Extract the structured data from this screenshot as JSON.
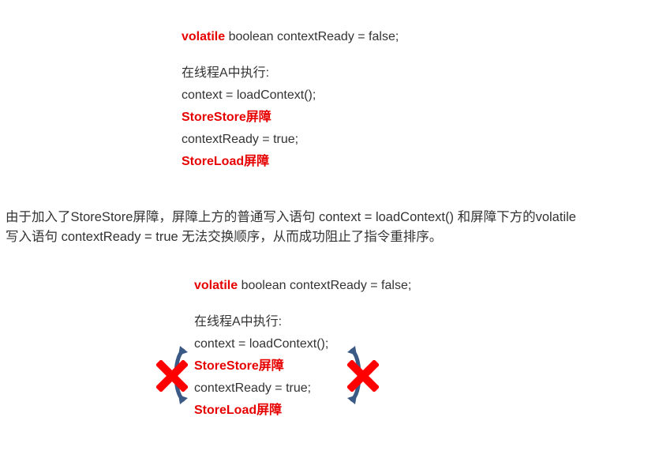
{
  "block1": {
    "decl_keyword": "volatile",
    "decl_rest": " boolean contextReady = false;",
    "thread_label": "在线程A中执行:",
    "line_context": "context = loadContext();",
    "barrier_storestore": "StoreStore屏障",
    "line_ready": "contextReady = true;",
    "barrier_storeload": "StoreLoad屏障"
  },
  "explanation": {
    "line1": "由于加入了StoreStore屏障，屏障上方的普通写入语句 context = loadContext()  和屏障下方的volatile",
    "line2": "写入语句 contextReady = true 无法交换顺序，从而成功阻止了指令重排序。"
  },
  "block2": {
    "decl_keyword": "volatile",
    "decl_rest": " boolean contextReady = false;",
    "thread_label": "在线程A中执行:",
    "line_context": "context = loadContext();",
    "barrier_storestore": "StoreStore屏障",
    "line_ready": "contextReady = true;",
    "barrier_storeload": "StoreLoad屏障"
  },
  "colors": {
    "keyword": "#e60000",
    "text": "#333333",
    "cross": "#ff0000",
    "arrow": "#3a5a85"
  },
  "icons": [
    "red-x-mark-icon",
    "curved-swap-arrow-icon"
  ]
}
